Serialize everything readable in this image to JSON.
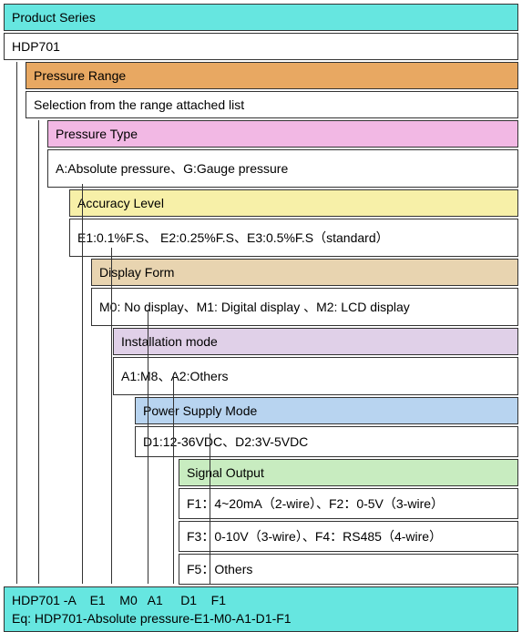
{
  "figure": {
    "lvl0": {
      "header": "Product Series",
      "value": "HDP701"
    },
    "lvl1": {
      "header": "Pressure Range",
      "value": "Selection from the range attached list"
    },
    "lvl2": {
      "header": "Pressure Type",
      "value": "A:Absolute pressure、G:Gauge pressure"
    },
    "lvl3": {
      "header": "Accuracy Level",
      "value": "E1:0.1%F.S、 E2:0.25%F.S、E3:0.5%F.S（standard）"
    },
    "lvl4": {
      "header": "Display Form",
      "value": "M0: No display、M1: Digital display 、M2: LCD display"
    },
    "lvl5": {
      "header": "Installation mode",
      "value": "A1:M8、A2:Others"
    },
    "lvl6": {
      "header": "Power Supply Mode",
      "value": "D1:12-36VDC、D2:3V-5VDC"
    },
    "lvl7": {
      "header": "Signal Output",
      "value1": "F1：4~20mA（2-wire）、F2：0-5V（3-wire）",
      "value2": "F3：0-10V（3-wire）、F4：RS485（4-wire）",
      "value3": "F5：Others"
    }
  },
  "footer": {
    "code": "HDP701 -A    E1    M0   A1     D1    F1",
    "example": "Eq: HDP701-Absolute pressure-E1-M0-A1-D1-F1"
  }
}
